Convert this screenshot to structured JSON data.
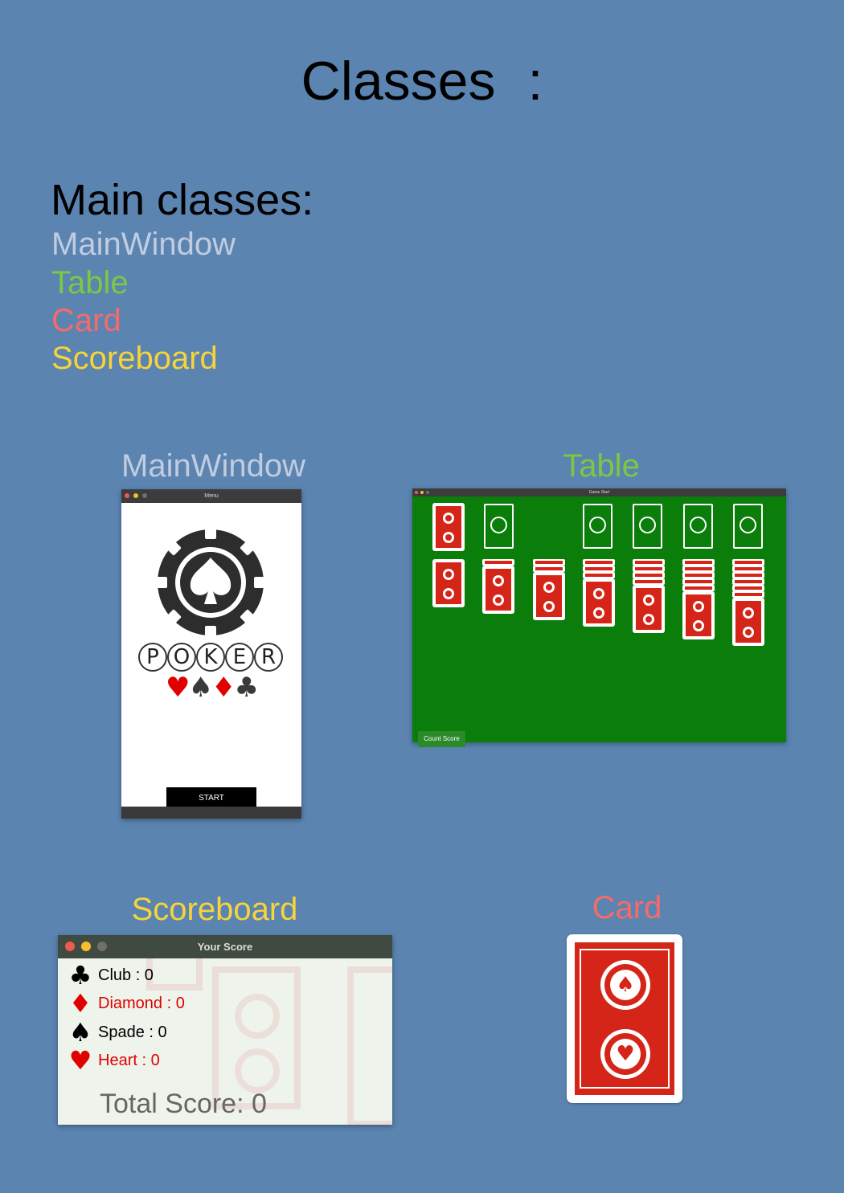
{
  "title": "Classes",
  "title_colon": ":",
  "main_heading": "Main classes:",
  "main_classes": [
    {
      "label": "MainWindow",
      "color": "#c0cce0"
    },
    {
      "label": "Table",
      "color": "#7ac943"
    },
    {
      "label": "Card",
      "color": "#f76a6a"
    },
    {
      "label": "Scoreboard",
      "color": "#f6d43a"
    }
  ],
  "labels": {
    "mainwindow": "MainWindow",
    "table": "Table",
    "scoreboard": "Scoreboard",
    "card": "Card"
  },
  "menu_window": {
    "title": "Menu",
    "poker_letters": [
      "P",
      "O",
      "K",
      "E",
      "R"
    ],
    "suits": [
      {
        "glyph": "♥",
        "color": "#e00000"
      },
      {
        "glyph": "♠",
        "color": "#3a3a3a"
      },
      {
        "glyph": "♦",
        "color": "#e00000"
      },
      {
        "glyph": "♣",
        "color": "#3a3a3a"
      }
    ],
    "start_label": "START"
  },
  "table_window": {
    "title": "Game Start",
    "count_score_label": "Count Score"
  },
  "score_window": {
    "title": "Your Score",
    "rows": [
      {
        "icon": "♣",
        "text": "Club : 0",
        "color": "#000000"
      },
      {
        "icon": "♦",
        "text": "Diamond : 0",
        "color": "#e00000"
      },
      {
        "icon": "♠",
        "text": "Spade : 0",
        "color": "#000000"
      },
      {
        "icon": "♥",
        "text": "Heart : 0",
        "color": "#e00000"
      }
    ],
    "total": "Total Score: 0"
  }
}
